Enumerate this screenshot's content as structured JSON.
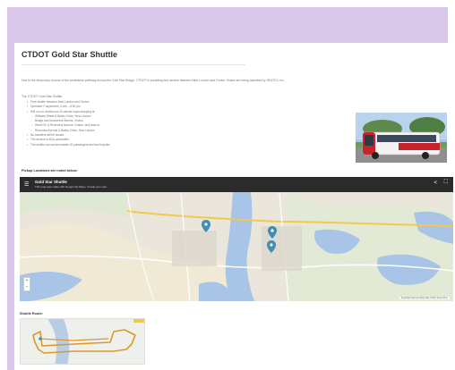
{
  "page": {
    "title": "CTDOT Gold Star Shuttle",
    "intro": "Due to the temporary closure of the pedestrian pathway across the Gold Star Bridge, CTDOT is providing bus service between New London and Groton. Buses are being operated by SEAT/CL Inc.",
    "lead": "The CTDOT Gold Star Shuttle:",
    "bullets": [
      {
        "text": "Free shuttle between New London and Groton",
        "level": 1
      },
      {
        "text": "Operates 7 days/week, 6 am – 8:30 pm",
        "level": 1
      },
      {
        "text": "Will run on continuous 20-minute loops stopping at:",
        "level": 1
      },
      {
        "text": "Williams Street & Bailey Circle, New London",
        "level": 2
      },
      {
        "text": "Bridge and Monument Streets, Groton",
        "level": 2
      },
      {
        "text": "Street St. & Riverview Avenue, Groton, and back to",
        "level": 2
      },
      {
        "text": "Riverview Avenue & Bailey Circle, New London",
        "level": 2
      },
      {
        "text": "No transfers will be issued.",
        "level": 1
      },
      {
        "text": "The service is ADA-accessible.",
        "level": 1
      },
      {
        "text": "The shuttle can accommodate 20 passengers and two bicycles",
        "level": 1
      }
    ],
    "pickup_label": "Pickup Locations are noted below:",
    "route_label": "Shuttle Route:"
  },
  "map": {
    "title": "Gold Star Shuttle",
    "subtitle": "This map was made with Google My Maps. Create your own.",
    "menu_icon": "menu-icon",
    "share_icon": "share-icon",
    "fullscreen_icon": "fullscreen-icon",
    "zoom_in": "+",
    "zoom_out": "−",
    "attribution": "Keyboard shortcuts   Map data ©2023   Terms   50 m"
  },
  "colors": {
    "frame": "#d9c8ea",
    "water": "#a8c4e6",
    "pin": "#3f8fb5",
    "route": "#d99a2b"
  }
}
